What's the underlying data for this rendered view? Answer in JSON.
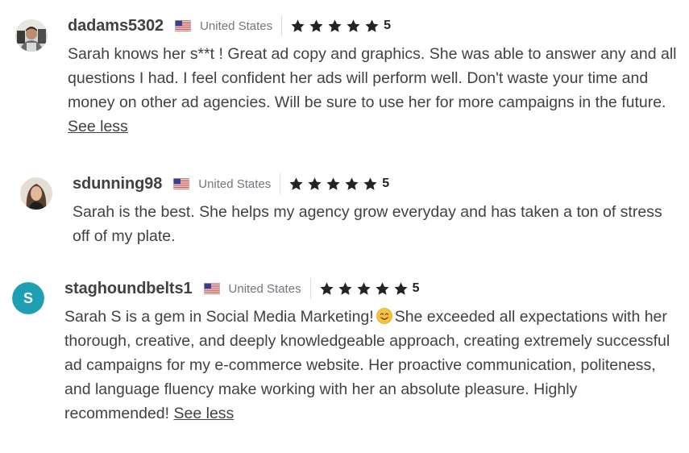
{
  "reviews": [
    {
      "username": "dadams5302",
      "country": "United States",
      "flag_icon": "us-flag-icon",
      "rating": "5",
      "stars": 5,
      "text": "Sarah knows her s**t ! Great ad copy and graphics. She was able to answer any and all questions I had. I feel confident her ads will perform well. Don't waste your time and money on other ad agencies. Will be sure to use her for more campaigns in the future.",
      "toggle_label": "See less"
    },
    {
      "username": "sdunning98",
      "country": "United States",
      "flag_icon": "us-flag-icon",
      "rating": "5",
      "stars": 5,
      "text": "Sarah is the best. She helps my agency grow everyday and has taken a ton of stress off of my plate."
    },
    {
      "username": "staghoundbelts1",
      "avatar_letter": "S",
      "avatar_color": "#1f9fb3",
      "country": "United States",
      "flag_icon": "us-flag-icon",
      "rating": "5",
      "stars": 5,
      "text_before_emoji": "Sarah S is a gem in Social Media Marketing!",
      "emoji": "smiling-face-icon",
      "text_after_emoji": "She exceeded all expectations with her thorough, creative, and deeply knowledgeable approach, creating extremely successful ad campaigns for my e-commerce website. Her proactive communication, politeness, and language fluency make working with her an absolute pleasure. Highly recommended!",
      "toggle_label": "See less"
    }
  ],
  "colors": {
    "text": "#404145",
    "muted": "#74767e",
    "star": "#222325",
    "divider": "#dadbdd"
  }
}
